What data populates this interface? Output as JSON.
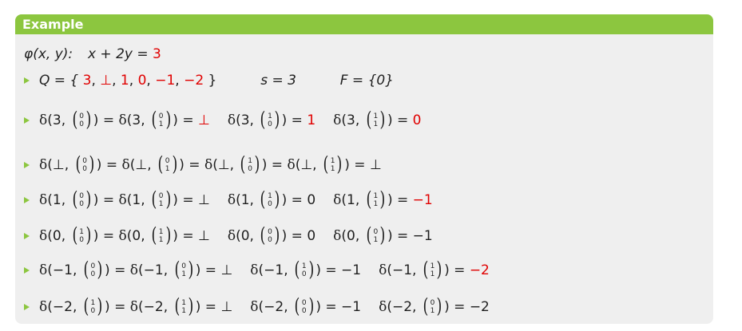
{
  "block": {
    "title": "Example",
    "formula": {
      "phi": "φ(x, y):",
      "lhs": "x + 2y = ",
      "rhs": "3"
    },
    "states_line": {
      "q_label": "Q = {",
      "q_values": [
        "3",
        "⊥",
        "1",
        "0",
        "−1",
        "−2"
      ],
      "q_close": "}",
      "s_text": "s = 3",
      "f_text": "F = {0}"
    },
    "transitions": [
      {
        "items": [
          {
            "state": "3",
            "vec": [
              "0",
              "0"
            ]
          },
          {
            "state": "3",
            "vec": [
              "0",
              "1"
            ],
            "result": "⊥",
            "red": true
          },
          {
            "state": "3",
            "vec": [
              "1",
              "0"
            ],
            "result": "1",
            "red": true
          },
          {
            "state": "3",
            "vec": [
              "1",
              "1"
            ],
            "result": "0",
            "red": true
          }
        ]
      },
      {
        "items": [
          {
            "state": "⊥",
            "vec": [
              "0",
              "0"
            ]
          },
          {
            "state": "⊥",
            "vec": [
              "0",
              "1"
            ]
          },
          {
            "state": "⊥",
            "vec": [
              "1",
              "0"
            ]
          },
          {
            "state": "⊥",
            "vec": [
              "1",
              "1"
            ],
            "result": "⊥",
            "red": false
          }
        ]
      },
      {
        "items": [
          {
            "state": "1",
            "vec": [
              "0",
              "0"
            ]
          },
          {
            "state": "1",
            "vec": [
              "0",
              "1"
            ],
            "result": "⊥",
            "red": false
          },
          {
            "state": "1",
            "vec": [
              "1",
              "0"
            ],
            "result": "0",
            "red": false
          },
          {
            "state": "1",
            "vec": [
              "1",
              "1"
            ],
            "result": "−1",
            "red": true
          }
        ]
      },
      {
        "items": [
          {
            "state": "0",
            "vec": [
              "1",
              "0"
            ]
          },
          {
            "state": "0",
            "vec": [
              "1",
              "1"
            ],
            "result": "⊥",
            "red": false
          },
          {
            "state": "0",
            "vec": [
              "0",
              "0"
            ],
            "result": "0",
            "red": false
          },
          {
            "state": "0",
            "vec": [
              "0",
              "1"
            ],
            "result": "−1",
            "red": false
          }
        ]
      },
      {
        "items": [
          {
            "state": "−1",
            "vec": [
              "0",
              "0"
            ]
          },
          {
            "state": "−1",
            "vec": [
              "0",
              "1"
            ],
            "result": "⊥",
            "red": false
          },
          {
            "state": "−1",
            "vec": [
              "1",
              "0"
            ],
            "result": "−1",
            "red": false
          },
          {
            "state": "−1",
            "vec": [
              "1",
              "1"
            ],
            "result": "−2",
            "red": true
          }
        ]
      },
      {
        "items": [
          {
            "state": "−2",
            "vec": [
              "1",
              "0"
            ]
          },
          {
            "state": "−2",
            "vec": [
              "1",
              "1"
            ],
            "result": "⊥",
            "red": false
          },
          {
            "state": "−2",
            "vec": [
              "0",
              "0"
            ],
            "result": "−1",
            "red": false
          },
          {
            "state": "−2",
            "vec": [
              "0",
              "1"
            ],
            "result": "−2",
            "red": false
          }
        ]
      }
    ]
  },
  "colors": {
    "accent": "#8cc63f",
    "highlight": "#e00000",
    "panel": "#efefef"
  }
}
